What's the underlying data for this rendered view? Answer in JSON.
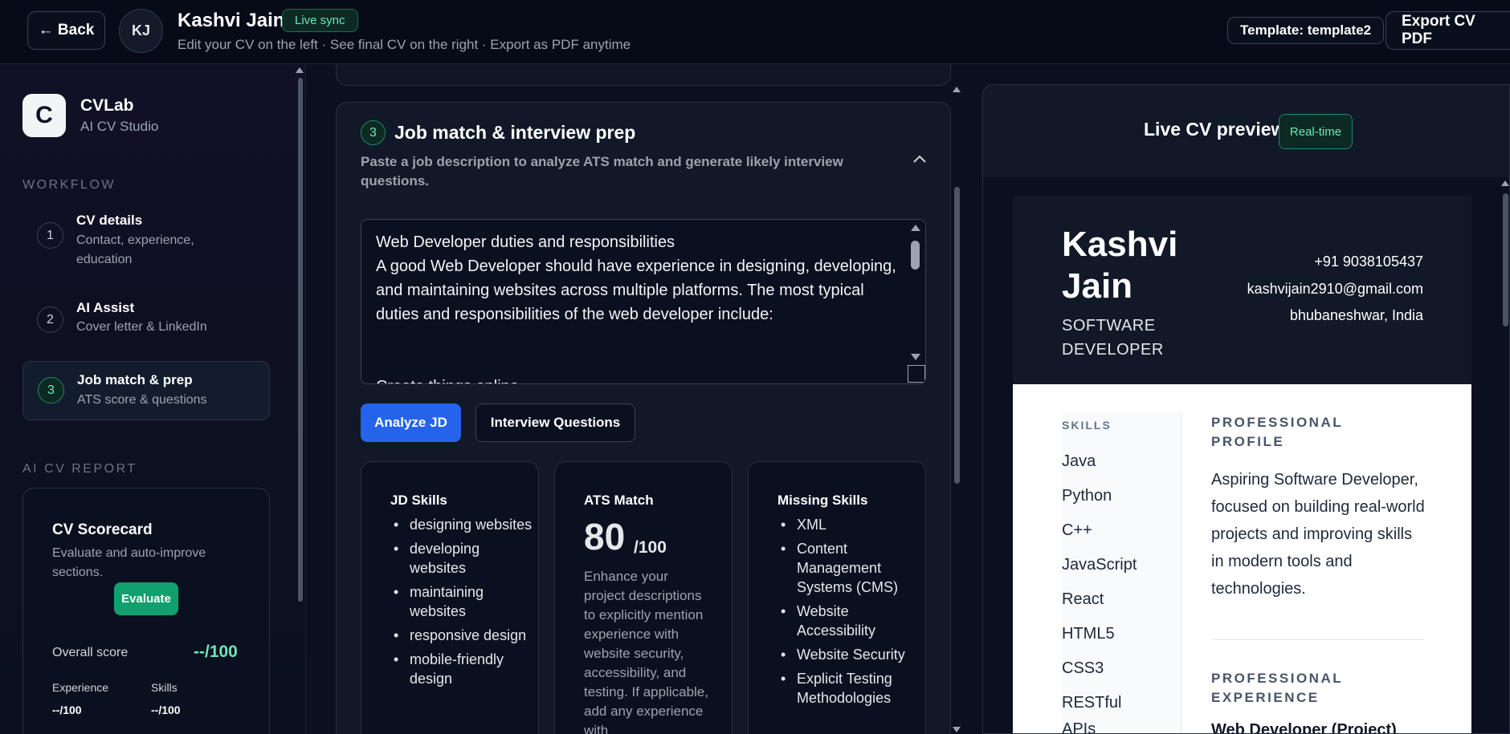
{
  "topbar": {
    "back_label": "← Back",
    "avatar_initials": "KJ",
    "user_name": "Kashvi Jain",
    "live_badge": "Live sync",
    "subtitle": "Edit your CV on the left · See final CV on the right · Export as PDF anytime",
    "template_label": "Template: template2",
    "export_label": "Export CV PDF"
  },
  "sidebar": {
    "logo_letter": "C",
    "brand_name": "CVLab",
    "brand_sub": "AI CV Studio",
    "workflow_label": "WORKFLOW",
    "workflow": [
      {
        "num": "1",
        "title": "CV details",
        "sub": "Contact, experience, education"
      },
      {
        "num": "2",
        "title": "AI Assist",
        "sub": "Cover letter & LinkedIn"
      },
      {
        "num": "3",
        "title": "Job match & prep",
        "sub": "ATS score & questions"
      }
    ],
    "report_label": "AI CV REPORT",
    "scorecard": {
      "title": "CV Scorecard",
      "sub": "Evaluate and auto-improve sections.",
      "evaluate_label": "Evaluate",
      "overall_label": "Overall score",
      "overall_value": "--/100",
      "experience_label": "Experience",
      "experience_value": "--/100",
      "skills_label": "Skills",
      "skills_value": "--/100"
    }
  },
  "job_match": {
    "step_num": "3",
    "title": "Job match & interview prep",
    "subtitle": "Paste a job description to analyze ATS match and generate likely interview questions.",
    "jd_text": "Web Developer duties and responsibilities\nA good Web Developer should have experience in designing, developing, and maintaining websites across multiple platforms. The most typical duties and responsibilities of the web developer include:\n\n\nCreate things online",
    "analyze_label": "Analyze JD",
    "interview_label": "Interview Questions",
    "jd_skills": {
      "title": "JD Skills",
      "items": [
        "designing websites",
        "developing websites",
        "maintaining websites",
        "responsive design",
        "mobile-friendly design"
      ]
    },
    "ats": {
      "title": "ATS Match",
      "score": "80",
      "max": "/100",
      "advice": "Enhance your project descriptions to explicitly mention experience with website security, accessibility, and testing. If applicable, add any experience with"
    },
    "missing": {
      "title": "Missing Skills",
      "items": [
        "XML",
        "Content Management Systems (CMS)",
        "Website Accessibility",
        "Website Security",
        "Explicit Testing Methodologies"
      ]
    }
  },
  "preview": {
    "title": "Live CV preview",
    "badge": "Real-time",
    "cv": {
      "first_name": "Kashvi",
      "last_name": "Jain",
      "role": "SOFTWARE DEVELOPER",
      "phone": "+91 9038105437",
      "email": "kashvijain2910@gmail.com",
      "location": "bhubaneshwar, India",
      "skills_label": "SKILLS",
      "skills": [
        "Java",
        "Python",
        "C++",
        "JavaScript",
        "React",
        "HTML5",
        "CSS3",
        "RESTful",
        "APIs"
      ],
      "profile_label": "PROFESSIONAL PROFILE",
      "profile_text": "Aspiring Software Developer, focused on building real-world projects and improving skills in modern tools and technologies.",
      "experience_label": "PROFESSIONAL EXPERIENCE",
      "job_title": "Web Developer (Project)"
    }
  },
  "colors": {
    "background": "#0b1020",
    "accent_green": "#10a06d",
    "accent_blue": "#2563eb",
    "badge_text": "#6ee7b7"
  }
}
